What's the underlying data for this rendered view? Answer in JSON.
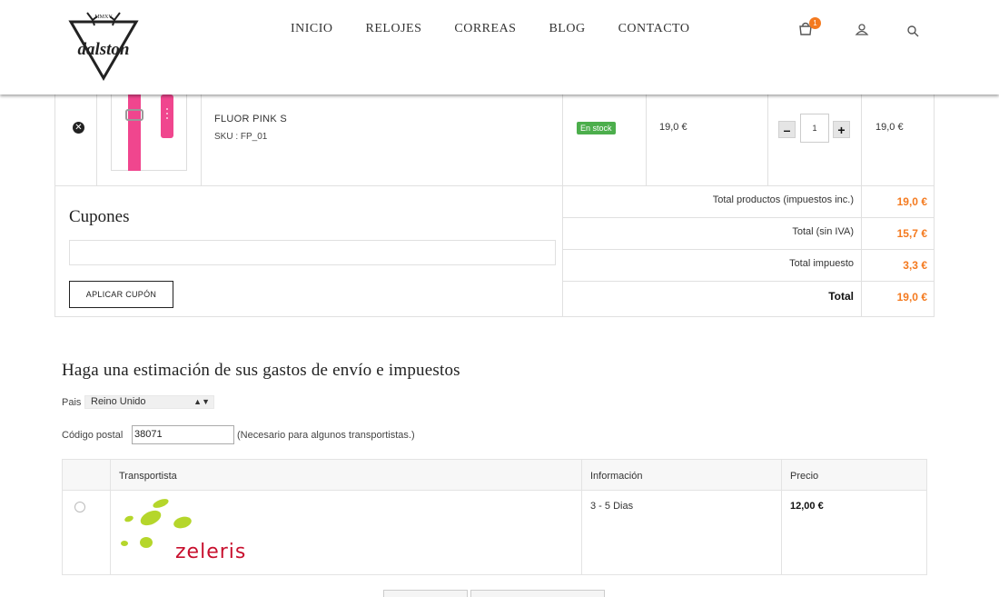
{
  "header": {
    "logo_top_text": "MMXV",
    "logo_text": "dalston",
    "nav": [
      {
        "label": "INICIO"
      },
      {
        "label": "RELOJES"
      },
      {
        "label": "CORREAS"
      },
      {
        "label": "BLOG"
      },
      {
        "label": "CONTACTO"
      }
    ],
    "cart_count": "1",
    "icons": [
      "cart-icon",
      "user-icon",
      "search-icon"
    ]
  },
  "cart": {
    "item": {
      "name": "FLUOR PINK S",
      "sku": "SKU : FP_01",
      "stock": "En stock",
      "unit_price": "19,0 €",
      "quantity": "1",
      "total_price": "19,0 €"
    },
    "coupon": {
      "title": "Cupones",
      "input_value": "",
      "button_label": "APLICAR CUPÓN"
    },
    "totals": [
      {
        "label": "Total productos (impuestos inc.)",
        "value": "19,0 €"
      },
      {
        "label": "Total (sin IVA)",
        "value": "15,7 €"
      },
      {
        "label": "Total impuesto",
        "value": "3,3 €"
      },
      {
        "label": "Total",
        "value": "19,0 €"
      }
    ]
  },
  "shipping": {
    "title": "Haga una estimación de sus gastos de envío e impuestos",
    "country_label": "Pais",
    "country_value": "Reino Unido",
    "postal_label": "Código postal",
    "postal_value": "38071",
    "postal_note": "(Necesario para algunos transportistas.)",
    "table": {
      "headers": [
        "Transportista",
        "Información",
        "Precio"
      ],
      "rows": [
        {
          "carrier": "zeleris",
          "info": "3 - 5 Dias",
          "price": "12,00 €"
        }
      ]
    }
  },
  "colors": {
    "accent": "#f47a1f",
    "stock_green": "#4cae4c",
    "strap_pink": "#f0468e",
    "zeleris_green": "#b5d62b",
    "zeleris_red": "#c8102e"
  }
}
